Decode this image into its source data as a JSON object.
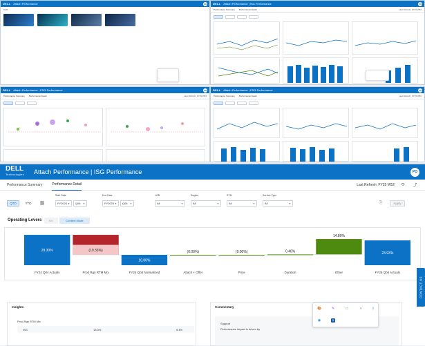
{
  "app": {
    "logo": "DELL",
    "logo_sub": "Technologies",
    "title": "Attach Performance | ISG Performance",
    "user_initials": "PO"
  },
  "windows": {
    "top_left_title": "Attach Performance",
    "top_left_tag": "CAN",
    "top_right_title": "Attach Performance | ISG Performance",
    "mid_left_title": "Attach Performance | CSG Performance",
    "mid_right_title": "Attach Performance | CSG Performance"
  },
  "tabs": [
    {
      "label": "Performance Summary",
      "active": false
    },
    {
      "label": "Performance Detail",
      "active": true
    }
  ],
  "last_refresh": "Last Refresh: FY25 W52",
  "filters": {
    "qtd": "QTD",
    "ytd": "YTD",
    "start_date_label": "Start Date",
    "start_fy": "FY2024",
    "start_q": "Q04",
    "end_date_label": "End Date",
    "end_fy": "FY2025",
    "end_q": "Q04",
    "lob_label": "LOB",
    "lob_value": "All",
    "region_label": "Region",
    "region_value": "All",
    "rtm_label": "RTM",
    "rtm_value": "All",
    "service_type_label": "Service Type",
    "service_type_value": "All",
    "apply": "Apply"
  },
  "levers": {
    "title": "Operating Levers",
    "pill_a": "Mix",
    "pill_b": "Content Mode"
  },
  "chart_data": {
    "type": "bar",
    "subtype": "waterfall",
    "categories": [
      "FY24 Q04 Actuals",
      "Prod Rgn RTM Mix",
      "FY24 Q04 Normalized",
      "Attach + Offer",
      "Price",
      "Duration",
      "Other",
      "FY25 Q04 Actuals"
    ],
    "values": [
      29.3,
      -19.33,
      10.0,
      -0.0,
      -0.0,
      0.4,
      14.89,
      23.93
    ],
    "labels": [
      "29.30%",
      "(19.33%)",
      "10.00%",
      "(0.00%)",
      "(0.00%)",
      "0.40%",
      "14.89%",
      "23.93%"
    ],
    "kinds": [
      "total",
      "delta",
      "total",
      "delta",
      "delta",
      "delta",
      "delta",
      "total"
    ],
    "colors": {
      "total": "#0b72c6",
      "negative": "#b3242b",
      "negative_light": "#f4c6c8",
      "positive": "#4f8a10",
      "connector": "#c9d2dc"
    }
  },
  "insights": {
    "title": "Insights",
    "sub_title": "Prod Rgn RTM Mix",
    "col1": "ISG",
    "col2": "13.3%",
    "col3": "9.4%"
  },
  "commentary": {
    "title": "Commentary",
    "line1": "Support",
    "line2": "Performance impact is driven by"
  },
  "contact_us": "CONTACT US",
  "icons": {
    "sync": "sync-icon",
    "trend": "trend-icon",
    "export": "export-icon",
    "tool_paint": "paint-icon",
    "tool_pen": "pen-icon",
    "tool_chat": "chat-icon",
    "tool_headset": "headset-icon",
    "tool_bluetooth": "bluetooth-icon",
    "tool_edge": "browser-icon",
    "tool_css": "code-icon"
  }
}
